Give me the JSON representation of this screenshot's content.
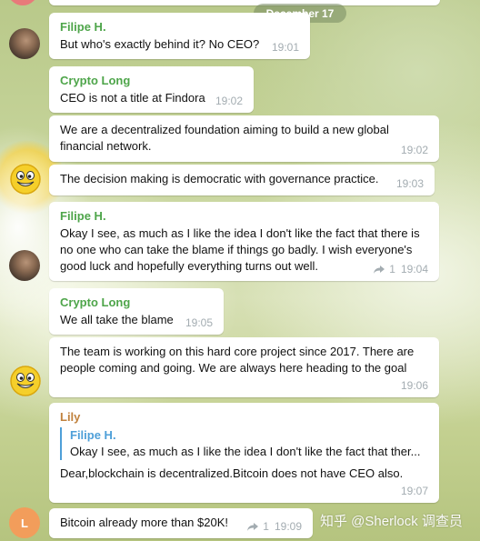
{
  "date_separator": "December 17",
  "messages": [
    {
      "sender": "Filipe H.",
      "text": "But who's exactly behind it? No CEO?",
      "time": "19:01"
    },
    {
      "sender": "Crypto Long",
      "text": "CEO is not a title at Findora",
      "time": "19:02"
    },
    {
      "text": "We are a decentralized foundation aiming to build a new global financial network.",
      "time": "19:02"
    },
    {
      "text": "The decision making is democratic with governance practice.",
      "time": "19:03"
    },
    {
      "sender": "Filipe H.",
      "text": "Okay I see, as much as I like the idea I don't like the fact that there is no one who can take the blame if things go badly. I wish everyone's good luck and hopefully everything turns out well.",
      "forwards": "1",
      "time": "19:04"
    },
    {
      "sender": "Crypto Long",
      "text": "We all take the blame",
      "time": "19:05"
    },
    {
      "text": "The team is working on this hard core project since 2017. There are people coming and going. We are always here heading to the goal",
      "time": "19:06"
    },
    {
      "sender": "Lily",
      "reply": {
        "name": "Filipe H.",
        "text": "Okay I see, as much as I like the idea I don't like the fact that ther..."
      },
      "text": "Dear,blockchain is decentralized.Bitcoin does not have CEO also.",
      "time": "19:07"
    },
    {
      "text": "Bitcoin already more than $20K!",
      "forwards": "1",
      "time": "19:09"
    }
  ],
  "avatars": {
    "lily_initial": "L"
  },
  "watermark": "知乎 @Sherlock 调查员",
  "colors": {
    "sender_green": "#4ea54a",
    "sender_brown": "#c0813d",
    "reply_blue": "#4e9fd8",
    "time_gray": "#a3acb1"
  }
}
